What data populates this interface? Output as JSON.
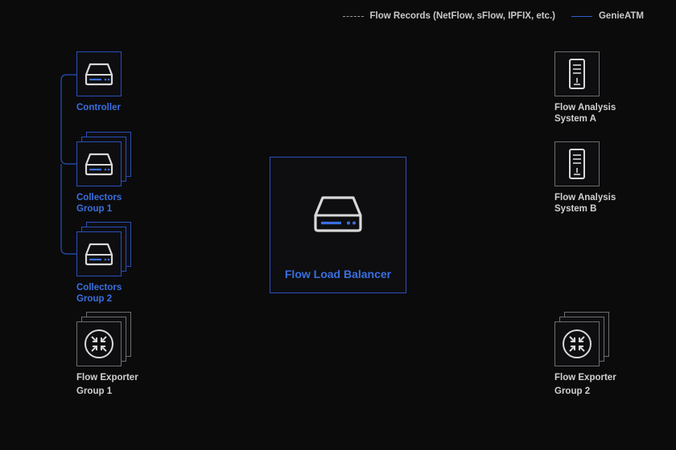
{
  "legend": {
    "flow_records": "Flow Records (NetFlow, sFlow, IPFIX, etc.)",
    "genieatm": "GenieATM"
  },
  "nodes": {
    "controller": {
      "label": "Controller"
    },
    "collectors_1": {
      "line1": "Collectors",
      "line2": "Group 1"
    },
    "collectors_2": {
      "line1": "Collectors",
      "line2": "Group 2"
    },
    "exporter_1": {
      "line1": "Flow Exporter",
      "line2": "Group 1"
    },
    "flow_load_balancer": {
      "label": "Flow Load Balancer"
    },
    "analysis_a": {
      "line1": "Flow Analysis",
      "line2": "System A"
    },
    "analysis_b": {
      "line1": "Flow Analysis",
      "line2": "System B"
    },
    "exporter_2": {
      "line1": "Flow Exporter",
      "line2": "Group 2"
    }
  },
  "colors": {
    "accent_blue": "#2a4fb8",
    "label_blue": "#3a6fe0",
    "icon_gray": "#d8d8d8",
    "background": "#0b0b0c"
  },
  "icons": {
    "controller": "server-icon",
    "collectors": "server-icon",
    "exporters": "router-icon",
    "analysis": "tower-server-icon"
  }
}
